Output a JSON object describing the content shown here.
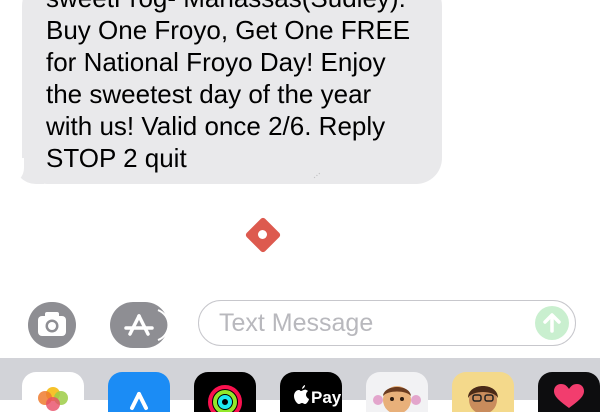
{
  "message": {
    "text": "sweetFrog- Manassas(Sudley):\nBuy One Froyo, Get One FREE\nfor National Froyo Day! Enjoy\nthe sweetest day of the year\nwith us! Valid once 2/6. Reply\nSTOP 2 quit"
  },
  "watermark": "...",
  "compose": {
    "placeholder": "Text Message"
  },
  "icons": {
    "camera": "camera-icon",
    "app_store": "app-store-icon",
    "send": "arrow-up-icon"
  },
  "app_drawer": {
    "apps": [
      {
        "name": "photos",
        "icon": "photos-icon"
      },
      {
        "name": "app-store",
        "icon": "app-store-icon"
      },
      {
        "name": "activity",
        "icon": "activity-rings-icon"
      },
      {
        "name": "apple-pay",
        "icon": "apple-pay-icon",
        "label": "Pay"
      },
      {
        "name": "memoji-1",
        "icon": "memoji-icon"
      },
      {
        "name": "memoji-2",
        "icon": "memoji-icon"
      },
      {
        "name": "digital-touch",
        "icon": "heart-icon"
      }
    ]
  },
  "colors": {
    "bubble": "#e9e9eb",
    "send_button": "#c9efcf",
    "tray": "#d2d3d8",
    "accent_red": "#dd5a4f"
  }
}
